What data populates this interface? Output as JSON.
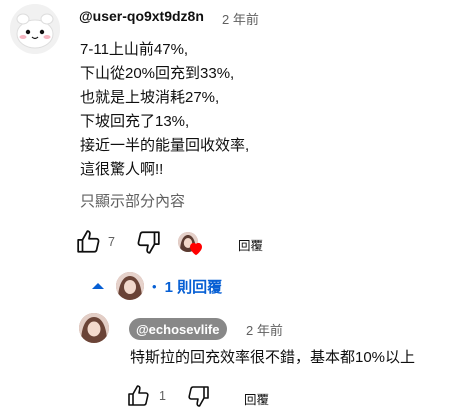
{
  "comment": {
    "author": "@user-qo9xt9dz8n",
    "time": "2 年前",
    "lines": [
      "7-11上山前47%,",
      "下山從20%回充到33%,",
      "也就是上坡消耗27%,",
      "下坡回充了13%,",
      "接近一半的能量回收效率,",
      "這很驚人啊!!"
    ],
    "show_partial": "只顯示部分內容",
    "like_count": "7",
    "reply_label": "回覆",
    "avatar_icon": "cartoon-face-avatar",
    "heart_color": "#ff0000"
  },
  "replies_toggle": {
    "label": "1 則回覆",
    "accent": "#065fd4"
  },
  "reply": {
    "author": "@echosevlife",
    "time": "2 年前",
    "text": "特斯拉的回充效率很不錯，基本都10%以上",
    "like_count": "1",
    "reply_label": "回覆"
  }
}
